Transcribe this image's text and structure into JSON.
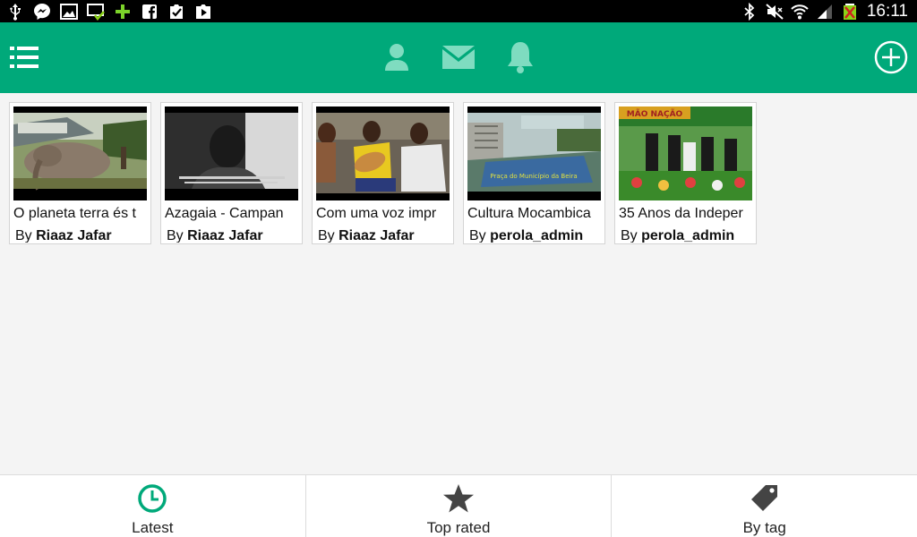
{
  "status_bar": {
    "time": "16:11",
    "left_icons": [
      "usb-icon",
      "messenger-icon",
      "gallery-icon",
      "screen-check-icon",
      "plus-icon",
      "facebook-icon",
      "clipboard-check-icon",
      "play-store-icon"
    ],
    "right_icons": [
      "bluetooth-icon",
      "mute-icon",
      "wifi-icon",
      "signal-icon",
      "battery-icon"
    ]
  },
  "toolbar": {
    "background": "#00a97a",
    "icons": [
      "menu-list-icon",
      "profile-icon",
      "mail-icon",
      "bell-icon",
      "add-circle-icon"
    ]
  },
  "videos": [
    {
      "title": "O planeta terra és t",
      "by": "By",
      "author": "Riaaz Jafar"
    },
    {
      "title": "Azagaia - Campan",
      "by": "By",
      "author": "Riaaz Jafar"
    },
    {
      "title": "Com uma voz impr",
      "by": "By",
      "author": "Riaaz Jafar"
    },
    {
      "title": "Cultura Mocambica",
      "by": "By",
      "author": "perola_admin"
    },
    {
      "title": "35 Anos da Indeper",
      "by": "By",
      "author": "perola_admin"
    }
  ],
  "thumb_captions": {
    "video_4": "Praça do Município da Beira",
    "video_5": "MÃO NAÇÃO"
  },
  "tabs": [
    {
      "label": "Latest",
      "icon": "clock-icon",
      "active": true
    },
    {
      "label": "Top rated",
      "icon": "star-icon",
      "active": false
    },
    {
      "label": "By tag",
      "icon": "tag-icon",
      "active": false
    }
  ],
  "colors": {
    "accent": "#00a97a",
    "toolbar_icon_inactive": "#7fdcc0",
    "tab_icon": "#444444"
  }
}
